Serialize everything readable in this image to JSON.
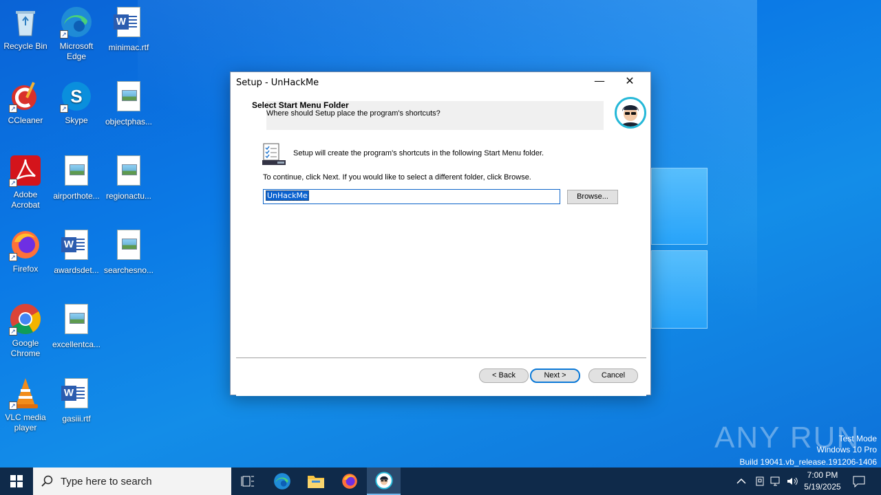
{
  "desktop": {
    "icons": [
      {
        "label": "Recycle Bin"
      },
      {
        "label": "Microsoft Edge"
      },
      {
        "label": "minimac.rtf"
      },
      {
        "label": "CCleaner"
      },
      {
        "label": "Skype"
      },
      {
        "label": "objectphas..."
      },
      {
        "label": "Adobe Acrobat"
      },
      {
        "label": "airporthote..."
      },
      {
        "label": "regionactu..."
      },
      {
        "label": "Firefox"
      },
      {
        "label": "awardsdet..."
      },
      {
        "label": "searchesno..."
      },
      {
        "label": "Google Chrome"
      },
      {
        "label": "excellentca..."
      },
      {
        "label": "VLC media player"
      },
      {
        "label": "gasiii.rtf"
      }
    ]
  },
  "window": {
    "title": "Setup - UnHackMe",
    "minimize_label": "—",
    "close_label": "✕",
    "header_title": "Select Start Menu Folder",
    "header_subtitle": "Where should Setup place the program's shortcuts?",
    "info_text": "Setup will create the program's shortcuts in the following Start Menu folder.",
    "instruction_text": "To continue, click Next. If you would like to select a different folder, click Browse.",
    "folder_value": "UnHackMe",
    "browse_label": "Browse...",
    "back_label": "< Back",
    "next_label": "Next >",
    "cancel_label": "Cancel"
  },
  "watermark": {
    "brand": "ANY RUN",
    "line1": "Test Mode",
    "line2": "Windows 10 Pro",
    "line3": "Build 19041.vb_release.191206-1406"
  },
  "taskbar": {
    "search_placeholder": "Type here to search",
    "time": "7:00 PM",
    "date": "5/19/2025"
  },
  "colors": {
    "accent": "#0a78d7",
    "taskbar": "#0f2a4a",
    "selection": "#0a62d0"
  }
}
